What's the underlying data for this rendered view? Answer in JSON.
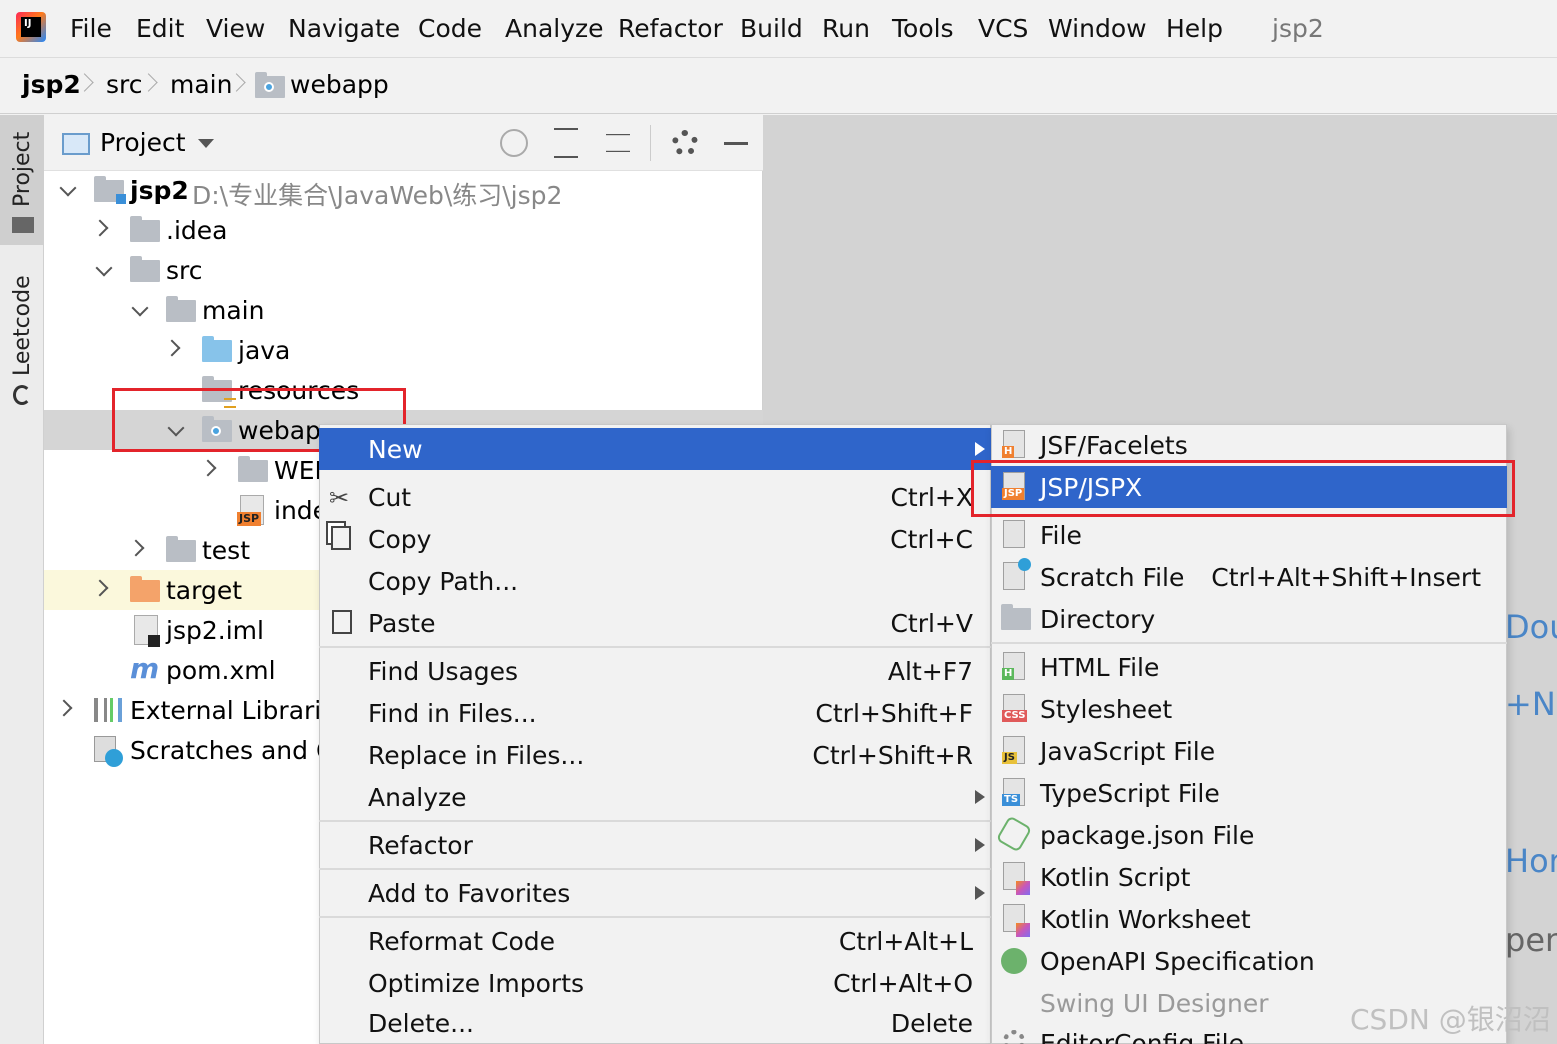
{
  "menubar": {
    "items": [
      {
        "label": "File"
      },
      {
        "label": "Edit"
      },
      {
        "label": "View"
      },
      {
        "label": "Navigate"
      },
      {
        "label": "Code"
      },
      {
        "label": "Analyze"
      },
      {
        "label": "Refactor"
      },
      {
        "label": "Build"
      },
      {
        "label": "Run"
      },
      {
        "label": "Tools"
      },
      {
        "label": "VCS"
      },
      {
        "label": "Window"
      },
      {
        "label": "Help"
      }
    ],
    "project_title": "jsp2",
    "logo_text": "IJ"
  },
  "breadcrumb": {
    "items": [
      "jsp2",
      "src",
      "main",
      "webapp"
    ]
  },
  "toolstrip": {
    "project_tab": "Project",
    "leetcode_tab": "Leetcode"
  },
  "panel": {
    "title": "Project"
  },
  "tree": {
    "root_name": "jsp2",
    "root_path": "D:\\专业集合\\JavaWeb\\练习\\jsp2",
    "idea": ".idea",
    "src": "src",
    "main": "main",
    "java": "java",
    "resources": "resources",
    "webapp": "webapp",
    "web_inf": "WEB",
    "index": "inde",
    "test": "test",
    "target": "target",
    "iml": "jsp2.iml",
    "pom": "pom.xml",
    "ext_libs": "External Libraries",
    "scratches": "Scratches and Co",
    "jsp_badge": "JSP"
  },
  "context_menu": {
    "items": [
      {
        "label": "New",
        "shortcut": "",
        "submenu": true
      },
      {
        "label": "Cut",
        "shortcut": "Ctrl+X"
      },
      {
        "label": "Copy",
        "shortcut": "Ctrl+C"
      },
      {
        "label": "Copy Path...",
        "shortcut": ""
      },
      {
        "label": "Paste",
        "shortcut": "Ctrl+V"
      },
      {
        "label": "Find Usages",
        "shortcut": "Alt+F7"
      },
      {
        "label": "Find in Files...",
        "shortcut": "Ctrl+Shift+F"
      },
      {
        "label": "Replace in Files...",
        "shortcut": "Ctrl+Shift+R"
      },
      {
        "label": "Analyze",
        "shortcut": "",
        "submenu": true
      },
      {
        "label": "Refactor",
        "shortcut": "",
        "submenu": true
      },
      {
        "label": "Add to Favorites",
        "shortcut": "",
        "submenu": true
      },
      {
        "label": "Reformat Code",
        "shortcut": "Ctrl+Alt+L"
      },
      {
        "label": "Optimize Imports",
        "shortcut": "Ctrl+Alt+O"
      },
      {
        "label": "Delete...",
        "shortcut": "Delete"
      }
    ]
  },
  "submenu": {
    "items": [
      {
        "label": "JSF/Facelets",
        "badge": "H"
      },
      {
        "label": "JSP/JSPX",
        "badge": "JSP"
      },
      {
        "label": "File",
        "badge": ""
      },
      {
        "label": "Scratch File",
        "shortcut": "Ctrl+Alt+Shift+Insert",
        "badge": ""
      },
      {
        "label": "Directory",
        "badge": ""
      },
      {
        "label": "HTML File",
        "badge": "H"
      },
      {
        "label": "Stylesheet",
        "badge": "CSS"
      },
      {
        "label": "JavaScript File",
        "badge": "JS"
      },
      {
        "label": "TypeScript File",
        "badge": "TS"
      },
      {
        "label": "package.json File",
        "badge": ""
      },
      {
        "label": "Kotlin Script",
        "badge": ""
      },
      {
        "label": "Kotlin Worksheet",
        "badge": ""
      },
      {
        "label": "OpenAPI Specification",
        "badge": ""
      },
      {
        "label": "Swing UI Designer",
        "badge": ""
      },
      {
        "label": "EditorConfig File",
        "badge": ""
      }
    ]
  },
  "editor_hints": {
    "a": "Dou",
    "b": "+N",
    "c": "Hor",
    "d": "pen"
  },
  "watermark": "CSDN @银沼沼",
  "colors": {
    "selection": "#2f65ca",
    "highlight_box": "#e3242b",
    "hint_text": "#4a86c7"
  }
}
